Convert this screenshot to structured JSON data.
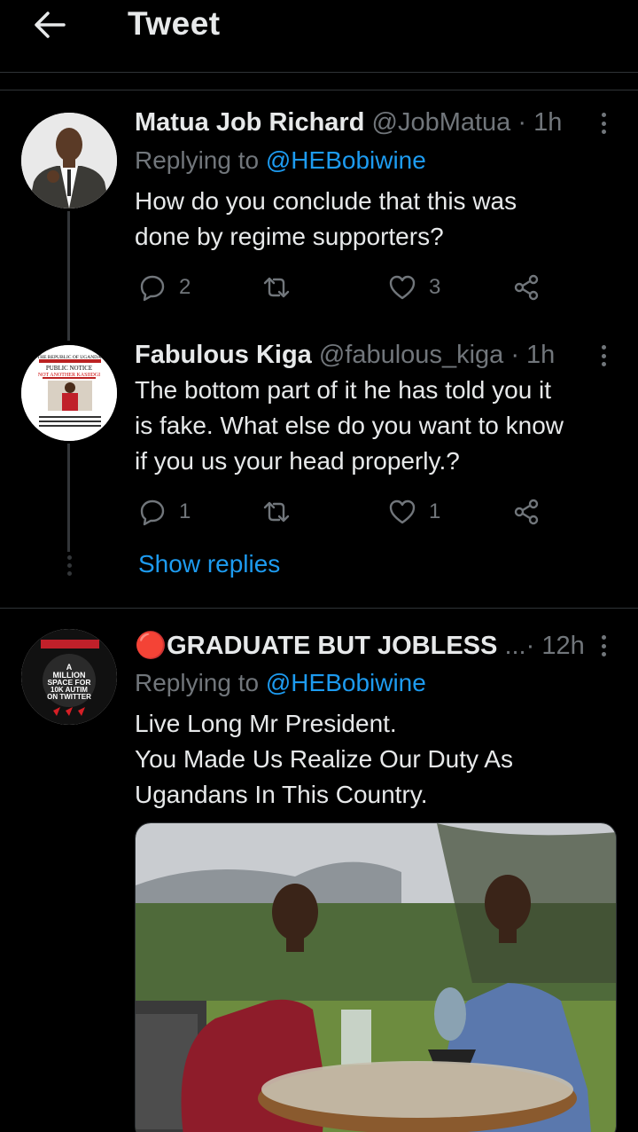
{
  "header": {
    "title": "Tweet"
  },
  "tweets": [
    {
      "name": "Matua Job Richard",
      "handle": "@JobMatua",
      "time": "· 1h",
      "replying_prefix": "Replying to ",
      "replying_to": "@HEBobiwine",
      "text_lines": [
        "How do you conclude that this was",
        "done by regime supporters?"
      ],
      "replies": "2",
      "retweets": "",
      "likes": "3"
    },
    {
      "name": "Fabulous Kiga",
      "handle": "@fabulous_kiga",
      "time": "· 1h",
      "text_lines": [
        "The bottom part of it he has told you it",
        "is fake. What else do you want to know",
        "if you us your head properly.?"
      ],
      "replies": "1",
      "retweets": "",
      "likes": "1",
      "avatar_text": [
        "THE REPUBLIC OF UGANDA",
        "PUBLIC NOTICE",
        "NOT ANOTHER KASIIDGI"
      ]
    },
    {
      "name_prefix": "🔴",
      "name": "GRADUATE BUT JOBLESS",
      "ellipsis": "...",
      "time": "· 12h",
      "replying_prefix": "Replying to ",
      "replying_to": "@HEBobiwine",
      "text_lines": [
        "Live Long Mr President.",
        "You Made Us Realize Our Duty As",
        "Ugandans In This Country."
      ],
      "avatar_text": [
        "A",
        "MILLION",
        "SPACE FOR",
        "10K AUTIM",
        "ON TWITTER"
      ]
    }
  ],
  "show_replies": "Show replies",
  "colors": {
    "accent": "#1d9bf0",
    "muted": "#71767b",
    "divider": "#2f3336",
    "background": "#000000"
  }
}
